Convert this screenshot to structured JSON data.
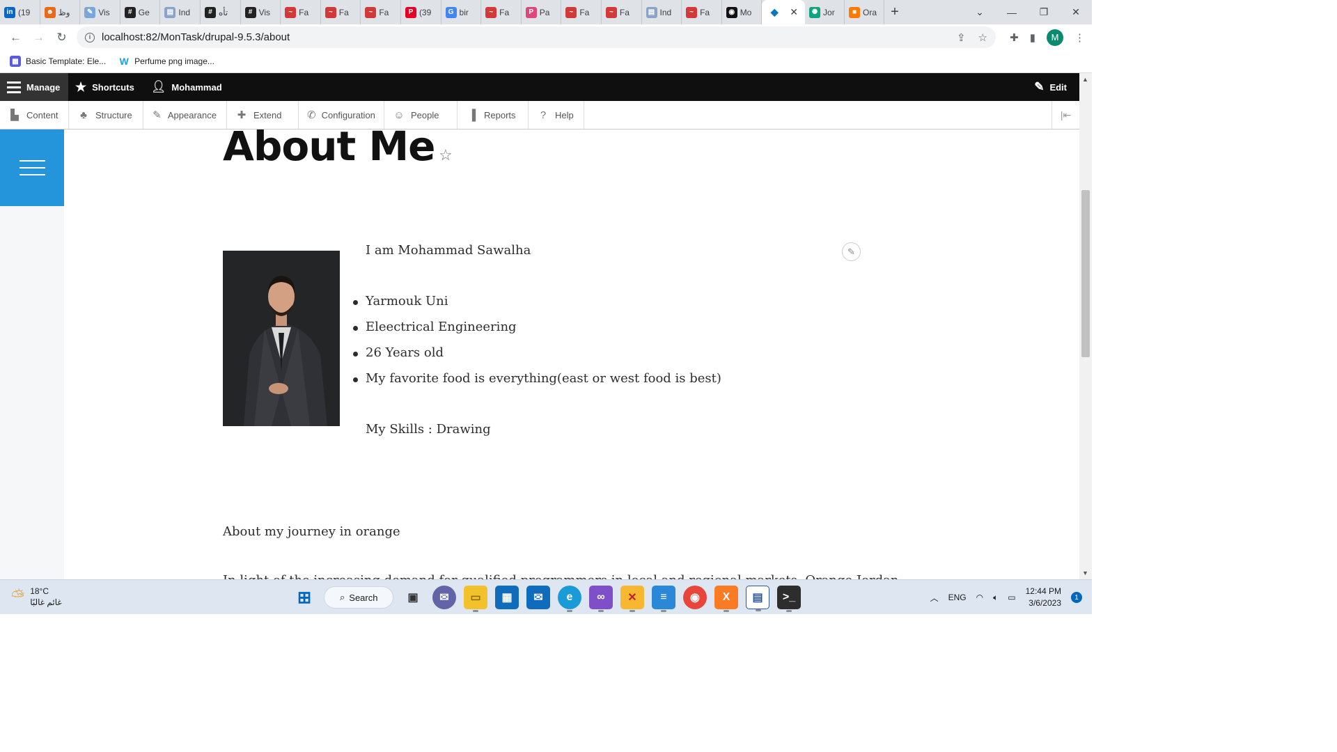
{
  "browser": {
    "tabs": [
      {
        "label": "(19",
        "icon": "linkedin-icon",
        "color": "#0a66c2",
        "glyph": "in"
      },
      {
        "label": "وظ",
        "icon": "face-icon",
        "color": "#e86a17",
        "glyph": "☻"
      },
      {
        "label": "Vis",
        "icon": "pen-icon",
        "color": "#7aa7d8",
        "glyph": "✎"
      },
      {
        "label": "Ge",
        "icon": "hashtag-icon",
        "color": "#222",
        "glyph": "#"
      },
      {
        "label": "Ind",
        "icon": "doc-icon",
        "color": "#8aa4c8",
        "glyph": "▤"
      },
      {
        "label": "تأه",
        "icon": "hashtag-icon",
        "color": "#222",
        "glyph": "#"
      },
      {
        "label": "Vis",
        "icon": "hashtag-icon",
        "color": "#222",
        "glyph": "#"
      },
      {
        "label": "Fa",
        "icon": "mustache-icon",
        "color": "#d23a3a",
        "glyph": "~"
      },
      {
        "label": "Fa",
        "icon": "mustache-icon",
        "color": "#d23a3a",
        "glyph": "~"
      },
      {
        "label": "Fa",
        "icon": "mustache-icon",
        "color": "#d23a3a",
        "glyph": "~"
      },
      {
        "label": "(39",
        "icon": "pinterest-icon",
        "color": "#e60023",
        "glyph": "P"
      },
      {
        "label": "bir",
        "icon": "google-icon",
        "color": "#4285f4",
        "glyph": "G"
      },
      {
        "label": "Fa",
        "icon": "mustache-icon",
        "color": "#d23a3a",
        "glyph": "~"
      },
      {
        "label": "Pa",
        "icon": "paypal-icon",
        "color": "#e0457b",
        "glyph": "P"
      },
      {
        "label": "Fa",
        "icon": "mustache-icon",
        "color": "#d23a3a",
        "glyph": "~"
      },
      {
        "label": "Fa",
        "icon": "mustache-icon",
        "color": "#d23a3a",
        "glyph": "~"
      },
      {
        "label": "Ind",
        "icon": "doc-icon",
        "color": "#8aa4c8",
        "glyph": "▤"
      },
      {
        "label": "Fa",
        "icon": "mustache-icon",
        "color": "#d23a3a",
        "glyph": "~"
      },
      {
        "label": "Mo",
        "icon": "github-icon",
        "color": "#111",
        "glyph": "◉"
      }
    ],
    "active_tab": {
      "icon": "drupal-icon",
      "color": "#0678be",
      "glyph": "◆"
    },
    "trailing_tabs": [
      {
        "label": "Jor",
        "icon": "chatgpt-icon",
        "color": "#10a37f",
        "glyph": "✺"
      },
      {
        "label": "Ora",
        "icon": "orange-icon",
        "color": "#ff7900",
        "glyph": "■"
      }
    ],
    "url": "localhost:82/MonTask/drupal-9.5.3/about",
    "profile_initial": "M",
    "bookmarks": [
      {
        "label": "Basic Template: Ele...",
        "icon": "template-icon",
        "color": "#5b5bd6"
      },
      {
        "label": "Perfume png image...",
        "icon": "w-logo-icon",
        "color": "#1ba1e2"
      }
    ]
  },
  "drupal": {
    "toolbar": {
      "manage": "Manage",
      "shortcuts": "Shortcuts",
      "user": "Mohammad",
      "edit": "Edit"
    },
    "tray": [
      {
        "label": "Content",
        "icon": "content-icon",
        "glyph": "▙"
      },
      {
        "label": "Structure",
        "icon": "structure-icon",
        "glyph": "♣"
      },
      {
        "label": "Appearance",
        "icon": "appearance-icon",
        "glyph": "✎"
      },
      {
        "label": "Extend",
        "icon": "extend-icon",
        "glyph": "✚"
      },
      {
        "label": "Configuration",
        "icon": "configuration-icon",
        "glyph": "✆"
      },
      {
        "label": "People",
        "icon": "people-icon",
        "glyph": "☺"
      },
      {
        "label": "Reports",
        "icon": "reports-icon",
        "glyph": "▐"
      },
      {
        "label": "Help",
        "icon": "help-icon",
        "glyph": "?"
      }
    ]
  },
  "page": {
    "title": "About Me",
    "intro": "I am Mohammad Sawalha",
    "facts": [
      "Yarmouk Uni",
      "Eleectrical Engineering",
      "26 Years old",
      "My favorite food is everything(east or west food is best)"
    ],
    "skills": "My Skills : Drawing",
    "journey_heading": "About my journey in orange",
    "journey_text": "In light of the increasing demand for qualified programmers in local and regional markets, Orange Jordan"
  },
  "taskbar": {
    "temperature": "18°C",
    "condition": "غائم غالبًا",
    "search": "Search",
    "language": "ENG",
    "time": "12:44 PM",
    "date": "3/6/2023",
    "notifications": "1"
  }
}
